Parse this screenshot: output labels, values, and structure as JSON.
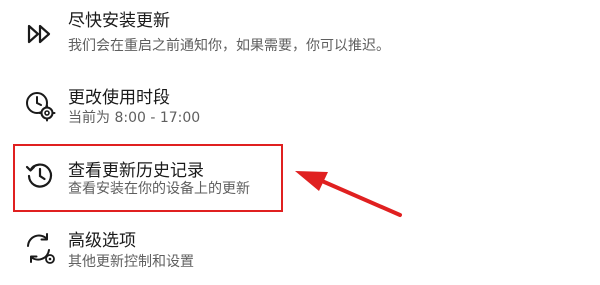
{
  "settings_items": [
    {
      "icon": "fast-forward-icon",
      "title": "尽快安装更新",
      "description": "我们会在重启之前通知你，如果需要，你可以推迟。"
    },
    {
      "icon": "clock-gear-icon",
      "title": "更改使用时段",
      "description": "当前为 8:00 - 17:00"
    },
    {
      "icon": "history-icon",
      "title": "查看更新历史记录",
      "description": "查看安装在你的设备上的更新"
    },
    {
      "icon": "sync-gear-icon",
      "title": "高级选项",
      "description": "其他更新控制和设置"
    }
  ],
  "annotation": {
    "highlight_color": "#e02020",
    "arrow_color": "#e02020"
  }
}
